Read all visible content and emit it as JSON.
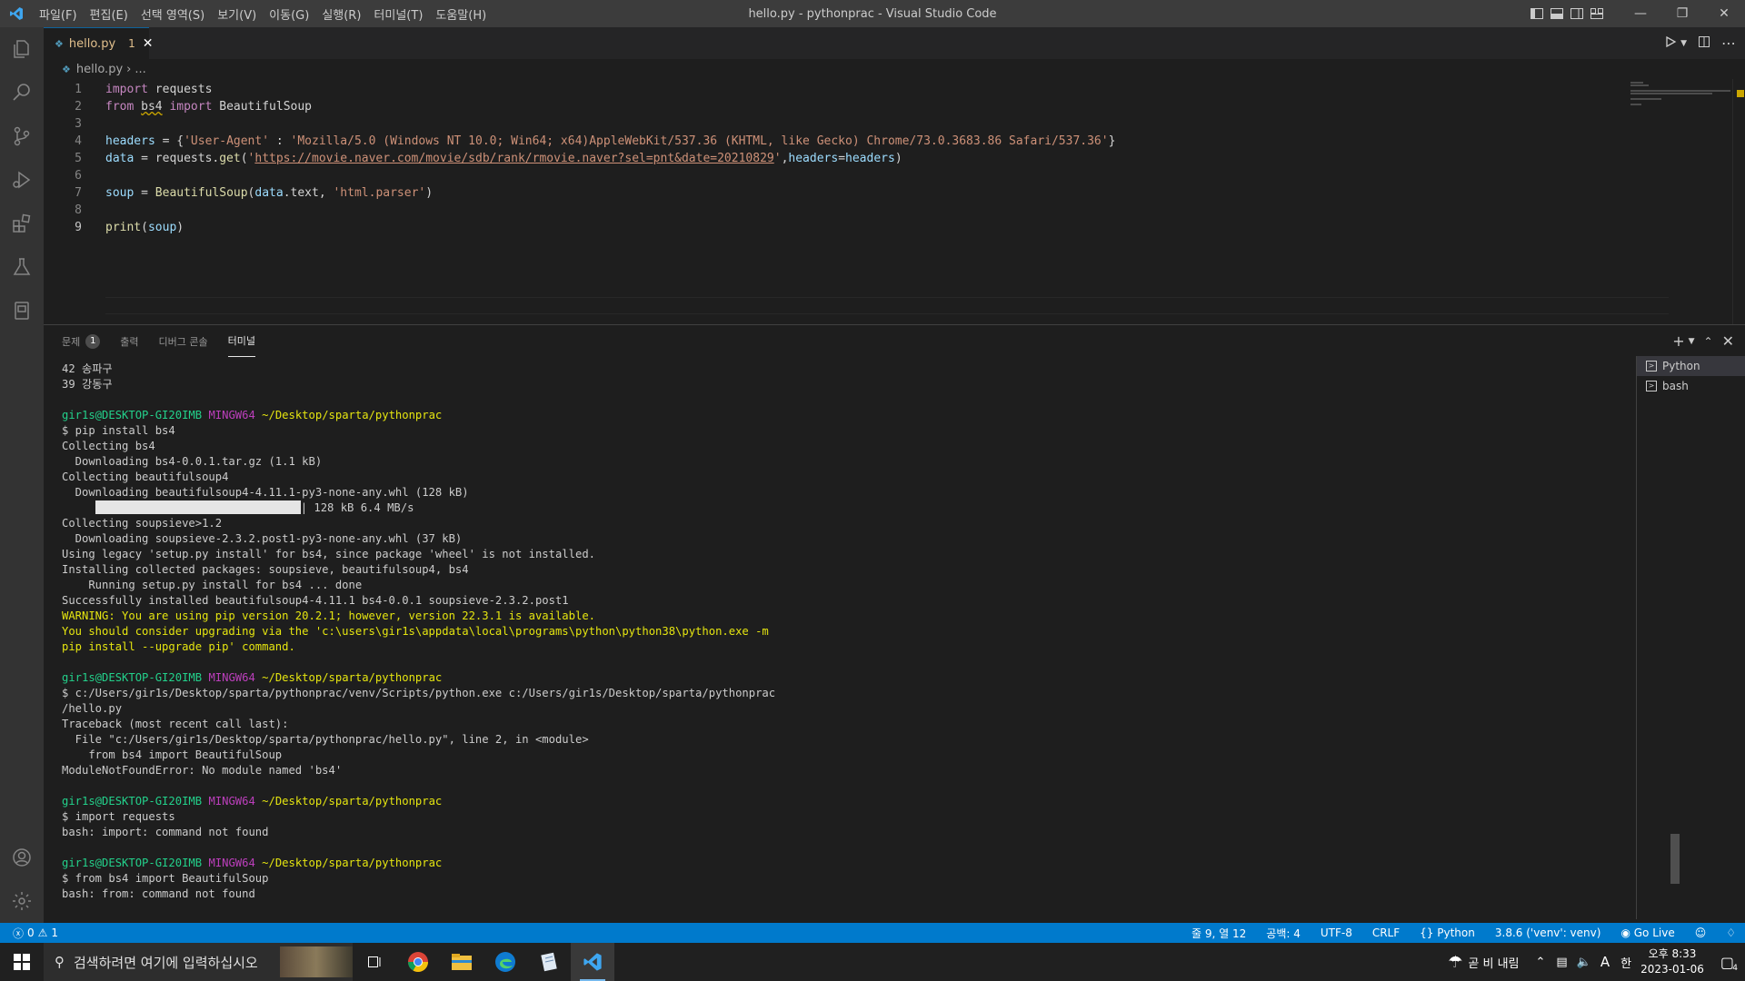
{
  "titlebar": {
    "menus": [
      "파일(F)",
      "편집(E)",
      "선택 영역(S)",
      "보기(V)",
      "이동(G)",
      "실행(R)",
      "터미널(T)",
      "도움말(H)"
    ],
    "title": "hello.py - pythonprac - Visual Studio Code"
  },
  "tabs": [
    {
      "name": "hello.py",
      "problems": "1"
    }
  ],
  "breadcrumb": {
    "file": "hello.py",
    "more": "..."
  },
  "panel": {
    "tabs": [
      "문제",
      "출력",
      "디버그 콘솔",
      "터미널"
    ],
    "problems_badge": "1",
    "terminals": [
      "Python",
      "bash"
    ]
  },
  "terminal": {
    "lines": [
      "42 송파구",
      "39 강동구",
      "",
      "gir1s@DESKTOP-GI20IMB MINGW64 ~/Desktop/sparta/pythonprac",
      "$ pip install bs4",
      "Collecting bs4",
      "  Downloading bs4-0.0.1.tar.gz (1.1 kB)",
      "Collecting beautifulsoup4",
      "  Downloading beautifulsoup4-4.11.1-py3-none-any.whl (128 kB)",
      "| 128 kB 6.4 MB/s",
      "Collecting soupsieve>1.2",
      "  Downloading soupsieve-2.3.2.post1-py3-none-any.whl (37 kB)",
      "Using legacy 'setup.py install' for bs4, since package 'wheel' is not installed.",
      "Installing collected packages: soupsieve, beautifulsoup4, bs4",
      "    Running setup.py install for bs4 ... done",
      "Successfully installed beautifulsoup4-4.11.1 bs4-0.0.1 soupsieve-2.3.2.post1",
      "WARNING: You are using pip version 20.2.1; however, version 22.3.1 is available.",
      "You should consider upgrading via the 'c:\\users\\gir1s\\appdata\\local\\programs\\python\\python38\\python.exe -m",
      "pip install --upgrade pip' command.",
      "",
      "gir1s@DESKTOP-GI20IMB MINGW64 ~/Desktop/sparta/pythonprac",
      "$ c:/Users/gir1s/Desktop/sparta/pythonprac/venv/Scripts/python.exe c:/Users/gir1s/Desktop/sparta/pythonprac",
      "/hello.py",
      "Traceback (most recent call last):",
      "  File \"c:/Users/gir1s/Desktop/sparta/pythonprac/hello.py\", line 2, in <module>",
      "    from bs4 import BeautifulSoup",
      "ModuleNotFoundError: No module named 'bs4'",
      "",
      "gir1s@DESKTOP-GI20IMB MINGW64 ~/Desktop/sparta/pythonprac",
      "$ import requests",
      "bash: import: command not found",
      "",
      "gir1s@DESKTOP-GI20IMB MINGW64 ~/Desktop/sparta/pythonprac",
      "$ from bs4 import BeautifulSoup",
      "bash: from: command not found"
    ],
    "prompt_user": "gir1s@DESKTOP-GI20IMB",
    "prompt_shell": "MINGW64",
    "prompt_path": "~/Desktop/sparta/pythonprac"
  },
  "status": {
    "errors": "0",
    "warnings": "1",
    "position": "줄 9, 열 12",
    "spaces": "공백: 4",
    "encoding": "UTF-8",
    "eol": "CRLF",
    "language": "Python",
    "interpreter": "3.8.6 ('venv': venv)",
    "golive": "Go Live"
  },
  "taskbar": {
    "search_placeholder": "검색하려면 여기에 입력하십시오",
    "weather": "곧 비 내림",
    "ime": "A",
    "ime2": "한",
    "time": "오후 8:33",
    "date": "2023-01-06",
    "notifications": "4"
  },
  "colors": {
    "accent": "#007acc",
    "prompt_green": "#23d18b",
    "prompt_purple": "#bc3fbc",
    "warning_yellow": "#e5e510"
  }
}
